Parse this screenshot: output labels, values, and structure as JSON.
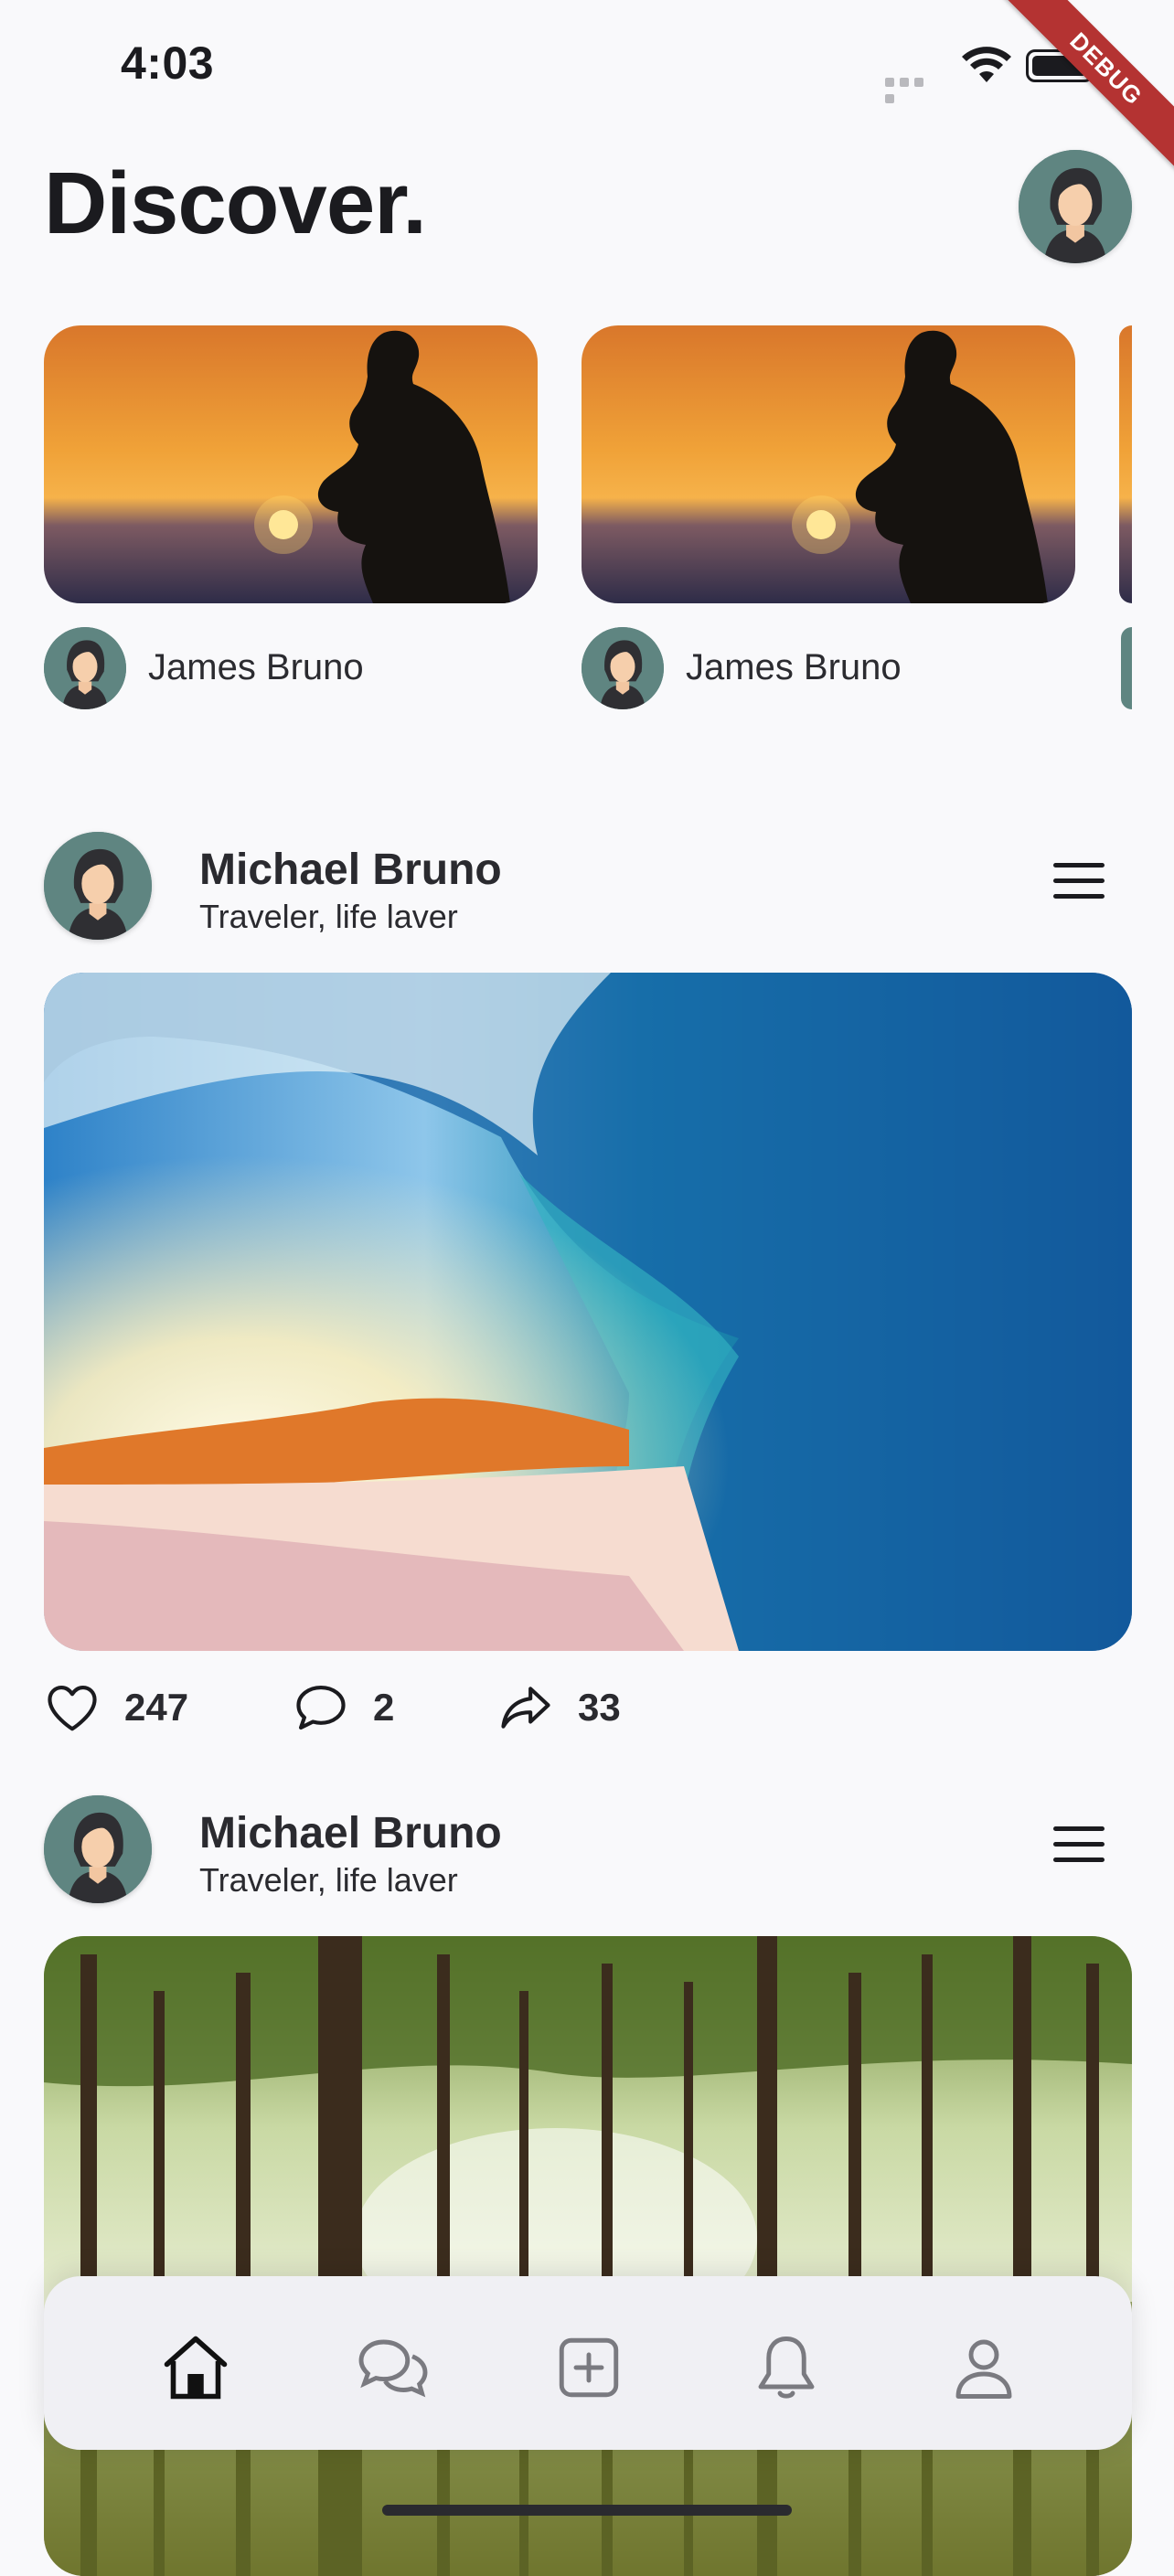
{
  "status_bar": {
    "time": "4:03"
  },
  "debug_banner": "DEBUG",
  "header": {
    "title": "Discover."
  },
  "stories": [
    {
      "author": "James Bruno"
    },
    {
      "author": "James Bruno"
    }
  ],
  "posts": [
    {
      "name": "Michael Bruno",
      "subtitle": "Traveler, life laver",
      "likes": "247",
      "comments": "2",
      "shares": "33"
    },
    {
      "name": "Michael Bruno",
      "subtitle": "Traveler, life laver"
    }
  ],
  "bottom_nav": {
    "items": [
      "home-icon",
      "chat-icon",
      "add-icon",
      "bell-icon",
      "profile-icon"
    ],
    "active": "home-icon"
  },
  "colors": {
    "avatar_bg": "#5f8581",
    "debug_banner": "#b43332",
    "background": "#f9f9fb"
  }
}
